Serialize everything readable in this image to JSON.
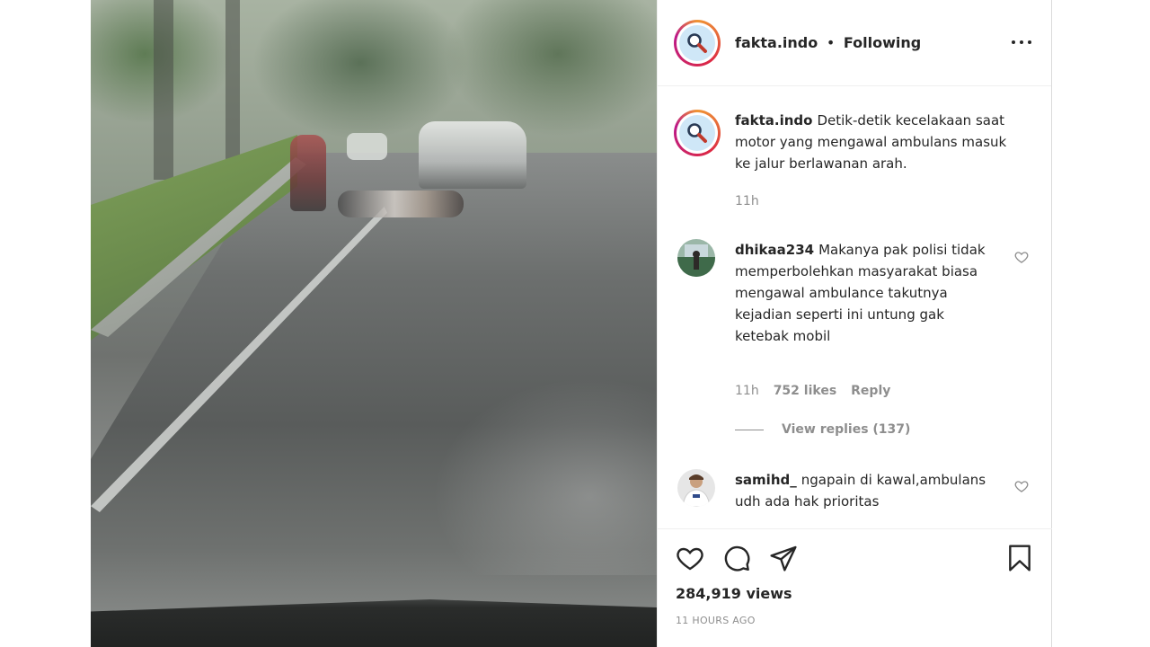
{
  "post": {
    "username": "fakta.indo",
    "separator": "•",
    "follow_status": "Following",
    "caption": "Detik-detik kecelakaan saat motor yang mengawal ambulans masuk ke jalur berlawanan arah.",
    "caption_time": "11h"
  },
  "comments": [
    {
      "username": "dhikaa234",
      "text": "Makanya pak polisi tidak memperbolehkan masyarakat biasa mengawal ambulance takutnya kejadian seperti ini untung gak ketebak mobil",
      "time": "11h",
      "likes": "752 likes",
      "reply_label": "Reply",
      "view_replies": "View replies (137)"
    },
    {
      "username": "samihd_",
      "text": "ngapain di kawal,ambulans udh ada hak prioritas"
    }
  ],
  "footer": {
    "views": "284,919 views",
    "time_ago": "11 HOURS AGO"
  },
  "icons": {
    "profile": "magnifier-icon",
    "more": "more-options-icon",
    "like": "heart-icon",
    "comment": "comment-icon",
    "share": "share-icon",
    "save": "bookmark-icon"
  },
  "colors": {
    "text": "#262626",
    "muted": "#8e8e8e",
    "border": "#efefef"
  }
}
